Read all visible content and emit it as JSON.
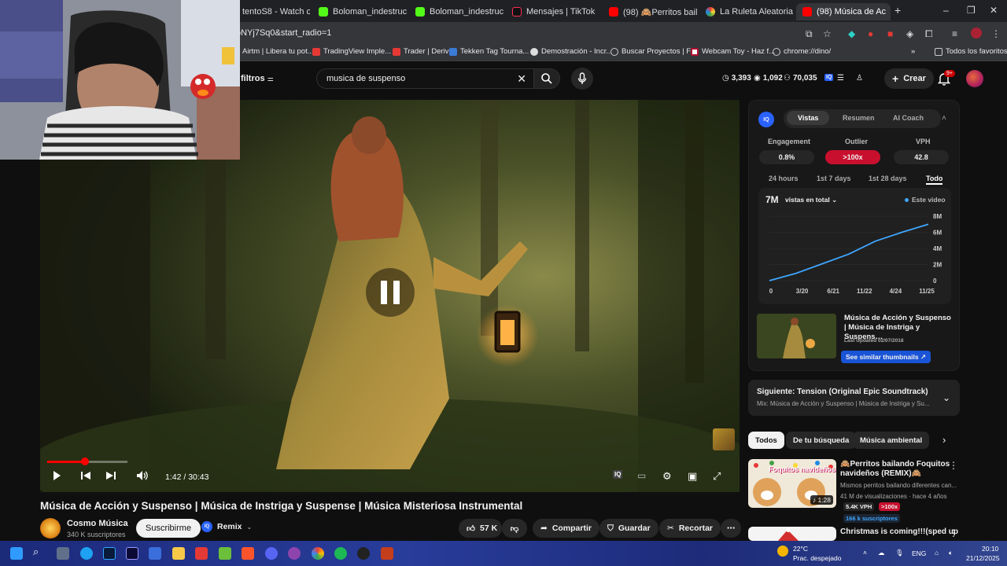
{
  "browser": {
    "tabs": [
      {
        "label": "tentoS8 - Watch c",
        "icon": "generic"
      },
      {
        "label": "Boloman_indestructib",
        "icon": "kick-icon"
      },
      {
        "label": "Boloman_indestructib",
        "icon": "kick-icon"
      },
      {
        "label": "Mensajes | TikTok",
        "icon": "tiktok-icon"
      },
      {
        "label": "(98) 🙈Perritos baila",
        "icon": "youtube-icon"
      },
      {
        "label": "La Ruleta Aleatoria",
        "icon": "wheel-icon"
      },
      {
        "label": "(98) Música de Ac",
        "icon": "youtube-icon"
      }
    ],
    "new_tab": "+",
    "url": "oNYj7Sq0&start_radio=1",
    "bookmarks": [
      "Airtm | Libera tu pot...",
      "TradingView Imple...",
      "Trader | Deriv",
      "Tekken Tag Tourna...",
      "Demostración - Incr...",
      "Buscar Proyectos | F...",
      "Webcam Toy - Haz f...",
      "chrome://dino/"
    ],
    "all_bookmarks": "Todos los favoritos"
  },
  "header": {
    "filters_label": "filtros",
    "search_value": "musica de suspenso",
    "stats": [
      "3,393",
      "1,092",
      "70,035"
    ],
    "create_label": "Crear",
    "notif_badge": "9+"
  },
  "player": {
    "time": "1:42 / 30:43",
    "progress_fraction": 0.055
  },
  "video": {
    "title": "Música de Acción y Suspenso | Música de Instriga y Suspense | Música Misteriosa Instrumental",
    "channel": "Cosmo Música",
    "subscribers": "340 K suscriptores",
    "subscribe_label": "Suscribirme",
    "remix_label": "Remix",
    "likes": "57 K",
    "share_label": "Compartir",
    "save_label": "Guardar",
    "clip_label": "Recortar"
  },
  "iq": {
    "tabs": [
      "Vistas",
      "Resumen",
      "AI Coach"
    ],
    "metrics": [
      {
        "label": "Engagement",
        "value": "0.8%"
      },
      {
        "label": "Outlier",
        "value": ">100x"
      },
      {
        "label": "VPH",
        "value": "42.8"
      }
    ],
    "ranges": [
      "24 hours",
      "1st 7 days",
      "1st 28 days",
      "Todo"
    ],
    "views_total": "7M",
    "views_select": "vistas en total",
    "this_video": "Este video",
    "similar": {
      "title": "Música de Acción y Suspenso | Música de Instriga y Suspens…",
      "updated": "Last Updated 02/07/2018",
      "button": "See similar thumbnails ↗"
    }
  },
  "chart_data": {
    "type": "line",
    "x": [
      "0",
      "3/20",
      "6/21",
      "11/22",
      "4/24",
      "11/25"
    ],
    "series": [
      {
        "values": [
          0,
          0.9,
          2.1,
          3.3,
          4.9,
          6.0,
          7.0
        ]
      }
    ],
    "y_ticks": [
      "0",
      "2M",
      "4M",
      "6M",
      "8M"
    ],
    "ylim": [
      0,
      8
    ]
  },
  "upnext": {
    "title": "Siguiente: Tension (Original Epic Soundtrack)",
    "subtitle": "Mix: Música de Acción y Suspenso | Música de Instriga y Su..."
  },
  "chips": [
    "Todos",
    "De tu búsqueda",
    "Música ambiental"
  ],
  "recs": [
    {
      "title": "🙈Perritos bailando Foquitos navideños (REMIX)🙈",
      "desc": "Mismos perritos bailando diferentes can...",
      "meta": "41 M de visualizaciones · hace 4 años",
      "vph": "5.4K VPH",
      "outlier": ">100x",
      "subs": "166 k suscriptores",
      "duration": "1:28",
      "thumb_text": "Foquitos navideños"
    },
    {
      "title": "Christmas is coming!!!(sped up",
      "desc": "",
      "meta": ""
    }
  ],
  "taskbar": {
    "weather_temp": "22°C",
    "weather_desc": "Prac. despejado",
    "lang": "ENG",
    "time": "20:10",
    "date": "21/12/2025"
  }
}
